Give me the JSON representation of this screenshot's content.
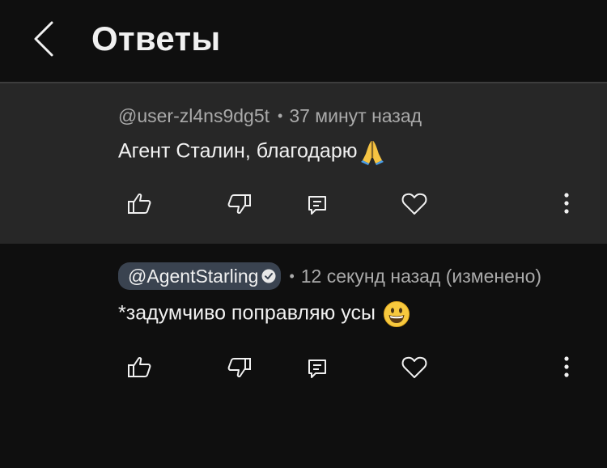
{
  "header": {
    "title": "Ответы",
    "back_icon": "chevron-left-icon"
  },
  "comments": [
    {
      "author": "@user-zl4ns9dg5t",
      "separator": "•",
      "time": "37 минут назад",
      "text": "Агент Сталин, благодарю",
      "emoji": "🙏",
      "highlighted": true,
      "author_is_creator": false
    },
    {
      "author": "@AgentStarling",
      "separator": "•",
      "time": "12 секунд назад (изменено)",
      "text": "*задумчиво поправляю усы",
      "emoji": "😃",
      "highlighted": false,
      "author_is_creator": true
    }
  ],
  "action_icons": [
    "thumbs-up-icon",
    "thumbs-down-icon",
    "reply-icon",
    "heart-icon",
    "more-vertical-icon"
  ],
  "colors": {
    "background": "#0f0f0f",
    "highlight_bg": "#272727",
    "chip_bg": "#3a4350",
    "secondary_text": "#aaaaaa"
  }
}
